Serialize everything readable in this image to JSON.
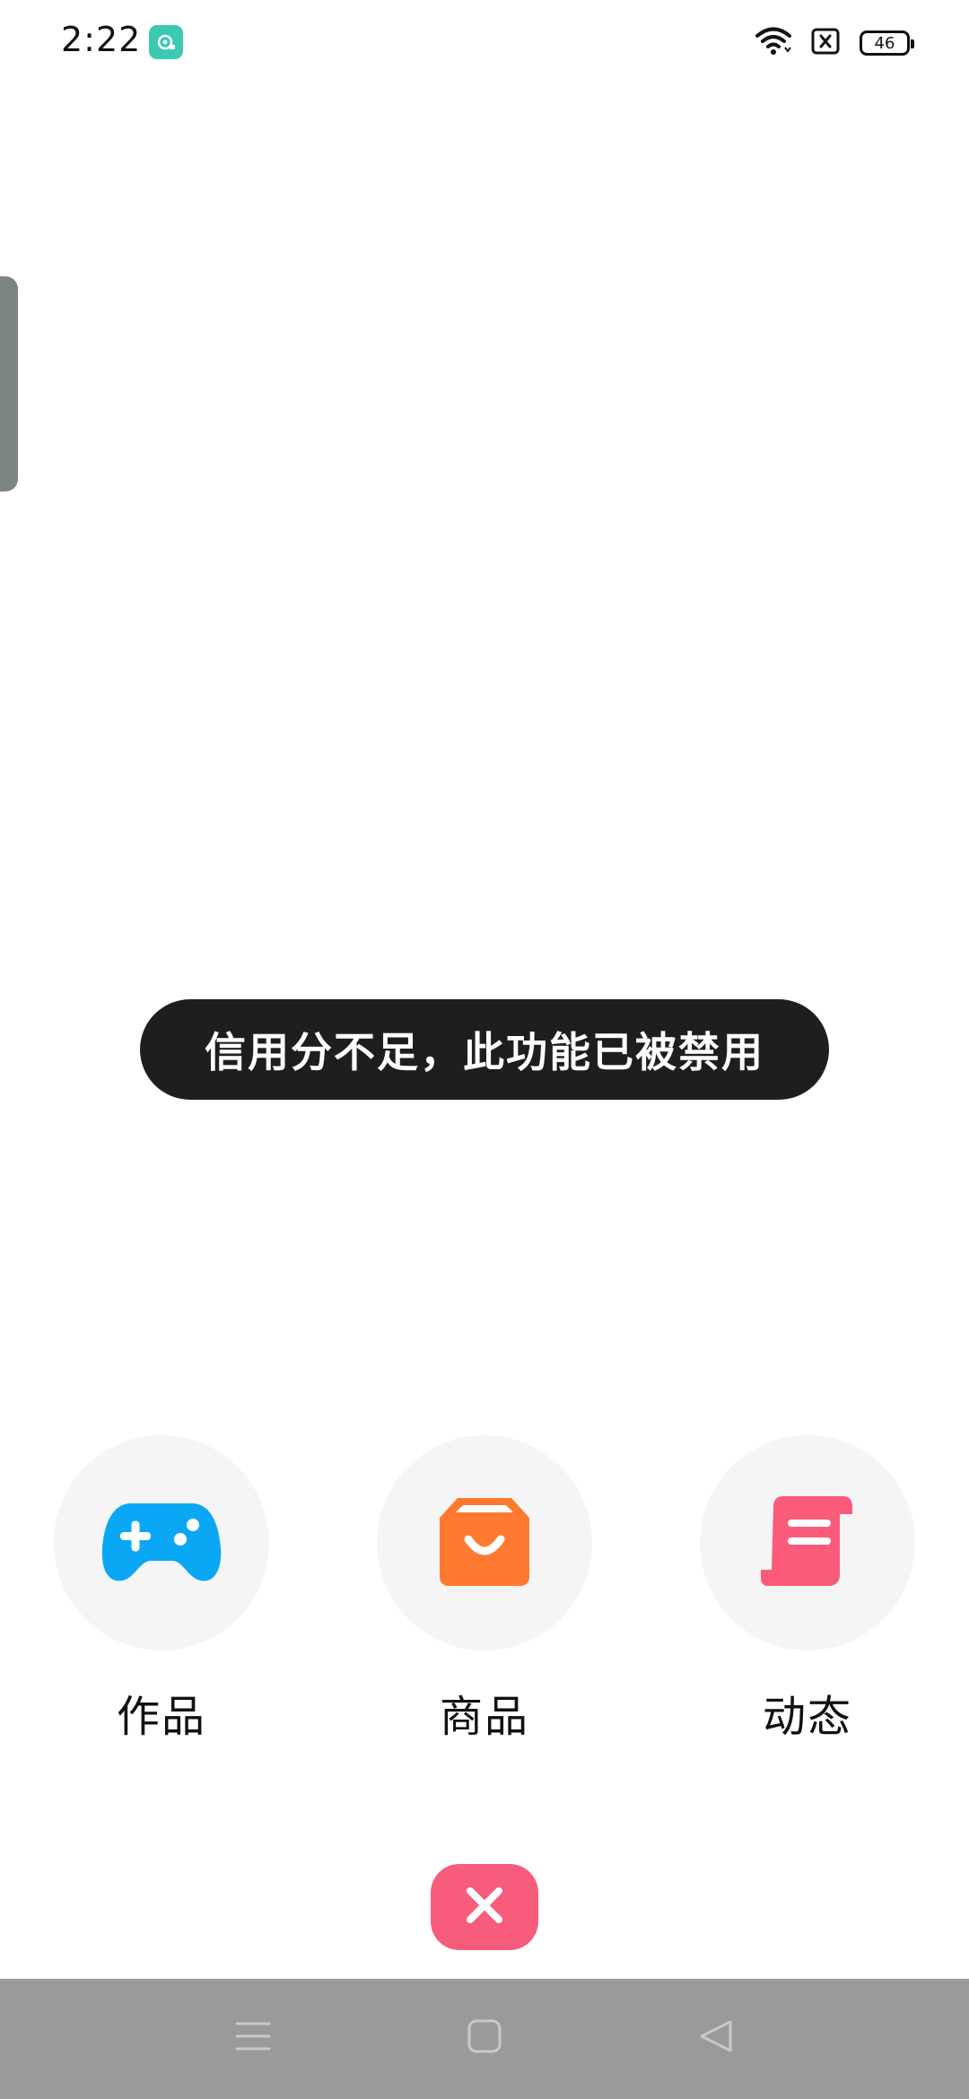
{
  "status_bar": {
    "time": "2:22",
    "battery_level": "46",
    "app_icon": "screen-record-icon",
    "icons": [
      "wifi-icon",
      "sim-off-icon",
      "battery-icon"
    ]
  },
  "toast": {
    "message": "信用分不足，此功能已被禁用"
  },
  "options": [
    {
      "label": "作品",
      "icon": "gamepad-icon",
      "color": "#0aa7f5"
    },
    {
      "label": "商品",
      "icon": "shopping-bag-icon",
      "color": "#ff7a30"
    },
    {
      "label": "动态",
      "icon": "scroll-icon",
      "color": "#fb5b7a"
    }
  ],
  "close_button": {
    "icon": "close-icon",
    "color": "#f75c7c"
  },
  "nav_bar": {
    "items": [
      "menu-icon",
      "home-icon",
      "back-icon"
    ],
    "color": "#9a9a9a"
  }
}
